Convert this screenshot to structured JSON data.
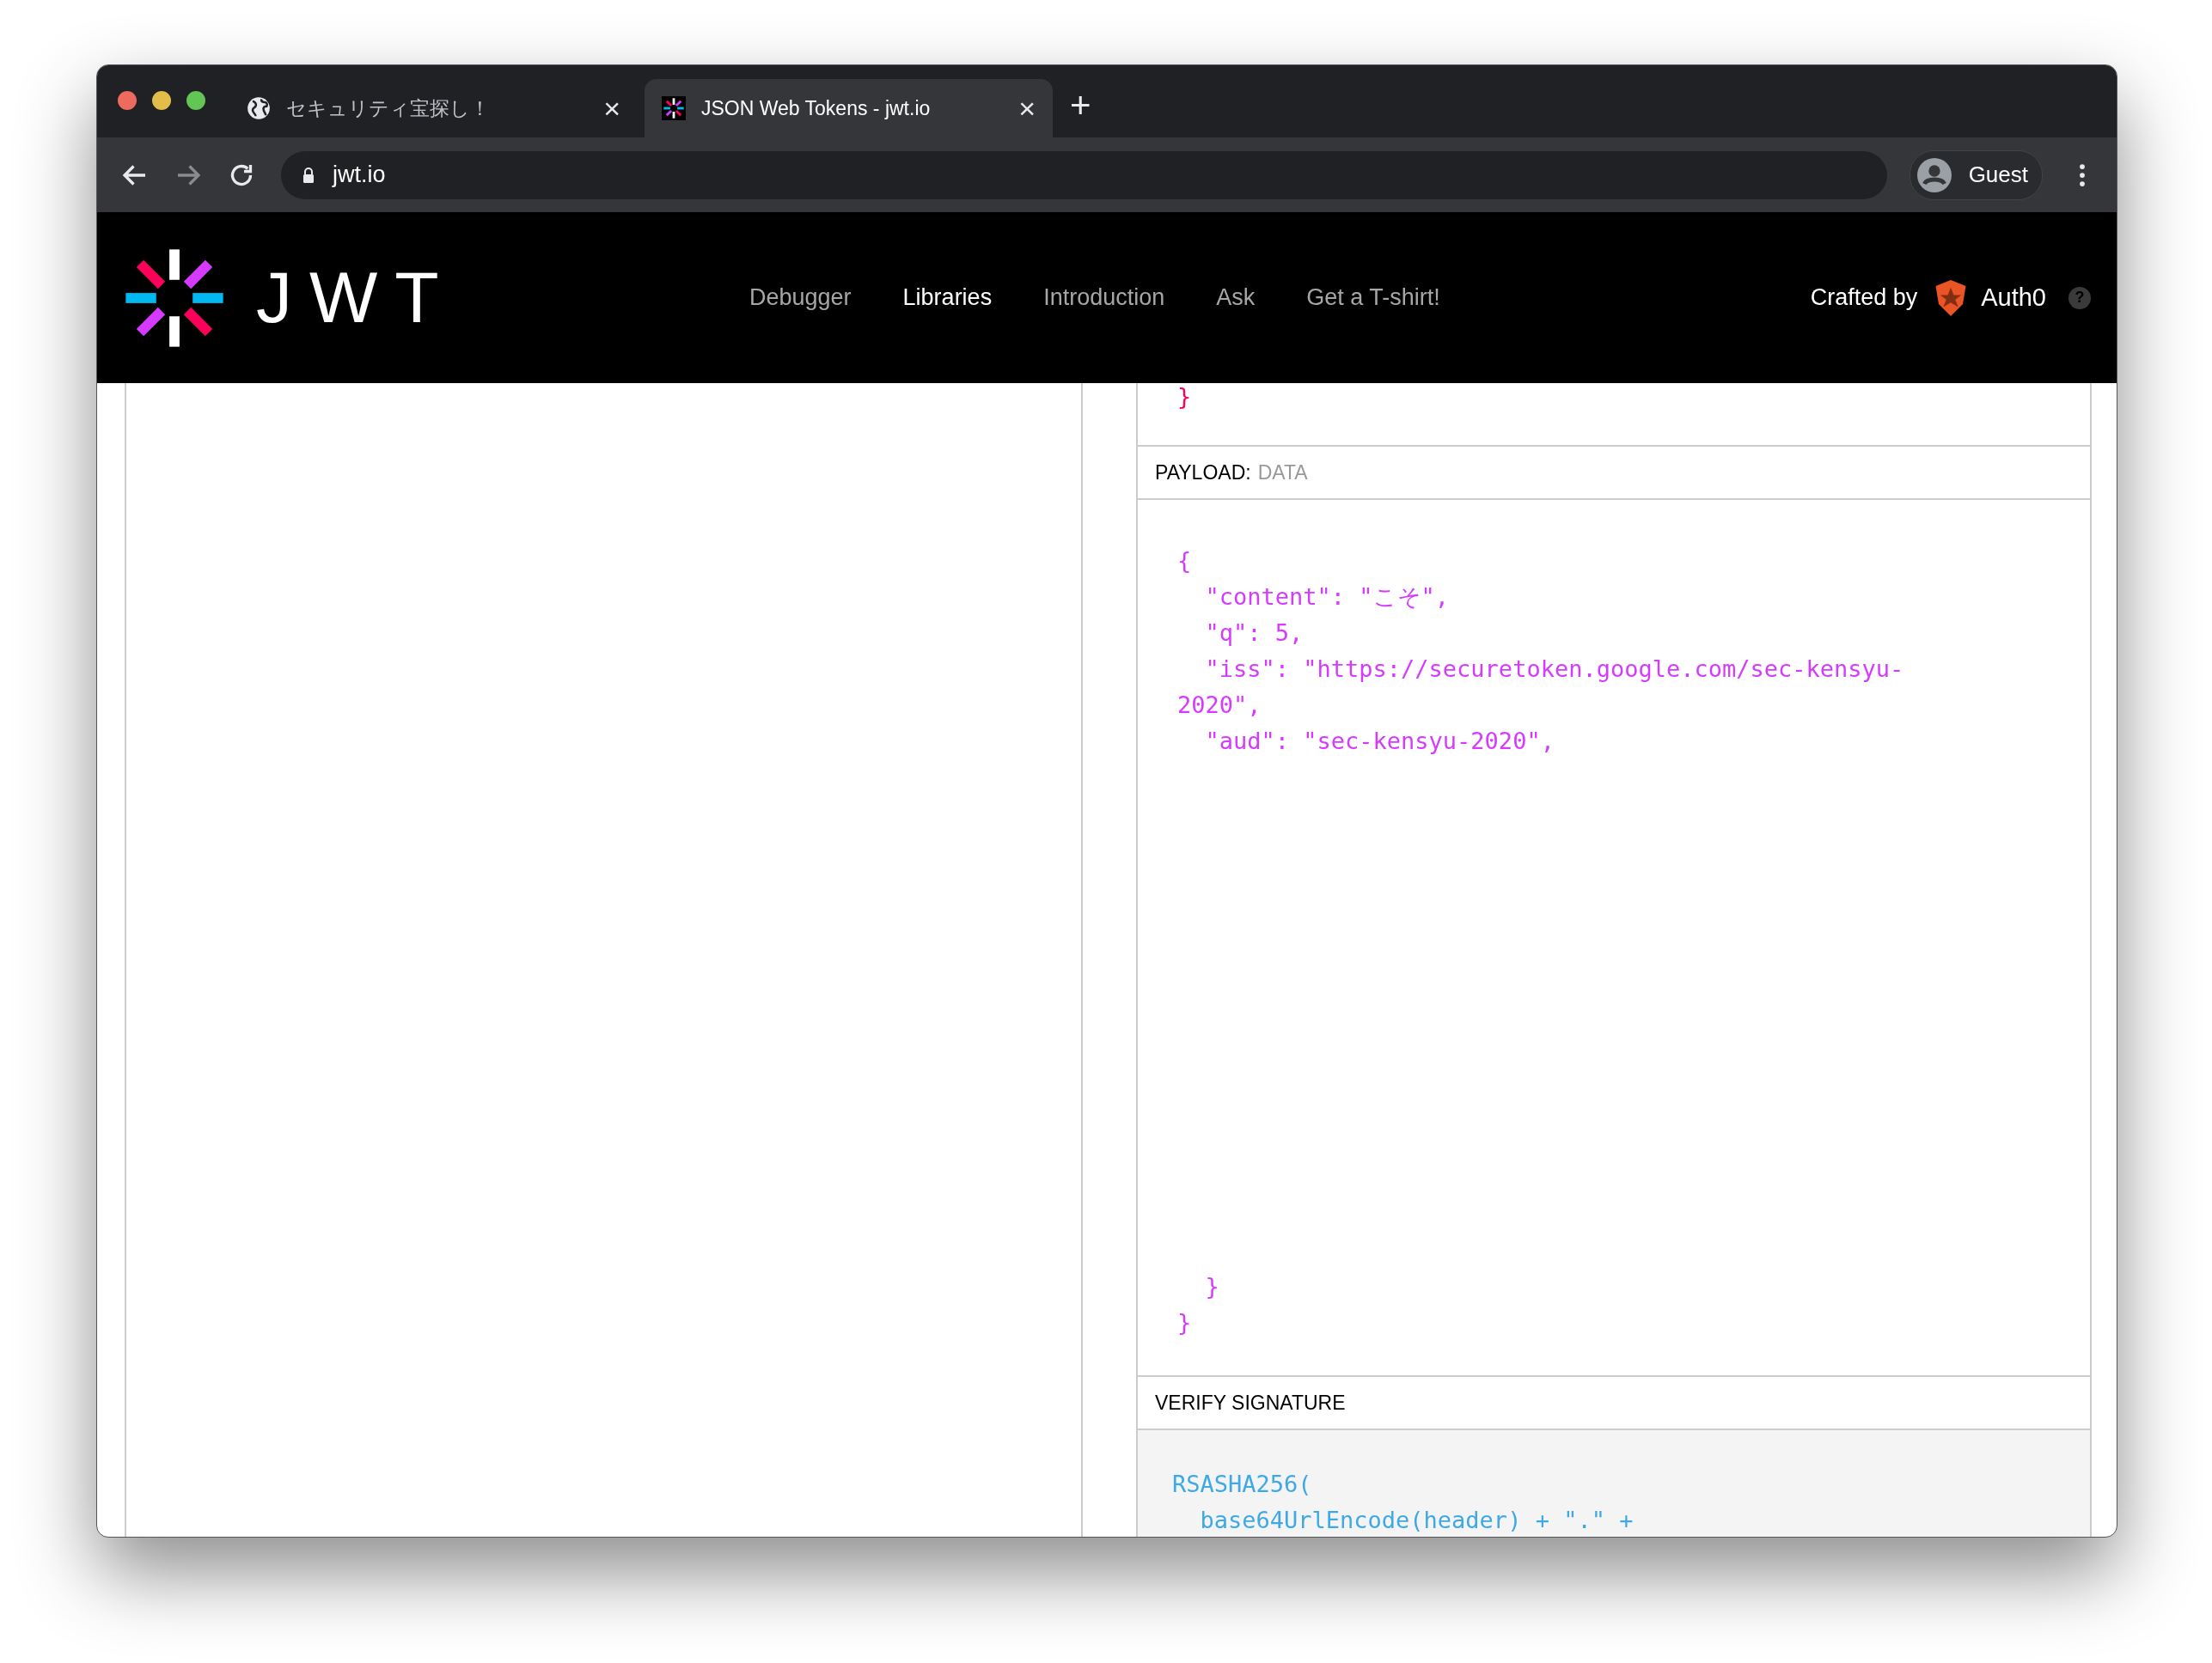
{
  "browser": {
    "tabs": [
      {
        "title": "セキュリティ宝探し！",
        "kind": "globe",
        "selected": false
      },
      {
        "title": "JSON Web Tokens - jwt.io",
        "kind": "favicon",
        "selected": true
      }
    ],
    "new_tab": "+",
    "close": "×",
    "address": "jwt.io",
    "profile": "Guest"
  },
  "header": {
    "logo_text": "JWT",
    "nav": [
      {
        "label": "Debugger",
        "selected": false
      },
      {
        "label": "Libraries",
        "selected": true
      },
      {
        "label": "Introduction",
        "selected": false
      },
      {
        "label": "Ask",
        "selected": false
      },
      {
        "label": "Get a T-shirt!",
        "selected": false
      }
    ],
    "crafted_by": "Crafted by",
    "brand": "Auth0",
    "help": "?"
  },
  "header_section": {
    "closing": "}"
  },
  "payload": {
    "label": "PAYLOAD:",
    "sublabel": "DATA",
    "lines_top": [
      "{",
      "  \"content\": \"こそ\",",
      "  \"q\": 5,",
      "  \"iss\": \"https://securetoken.google.com/sec-kensyu-",
      "2020\",",
      "  \"aud\": \"sec-kensyu-2020\","
    ],
    "lines_bottom": [
      "  }",
      "}"
    ]
  },
  "verify": {
    "label": "VERIFY SIGNATURE",
    "lines": [
      "RSASHA256(",
      "  base64UrlEncode(header) + \".\" +"
    ]
  }
}
